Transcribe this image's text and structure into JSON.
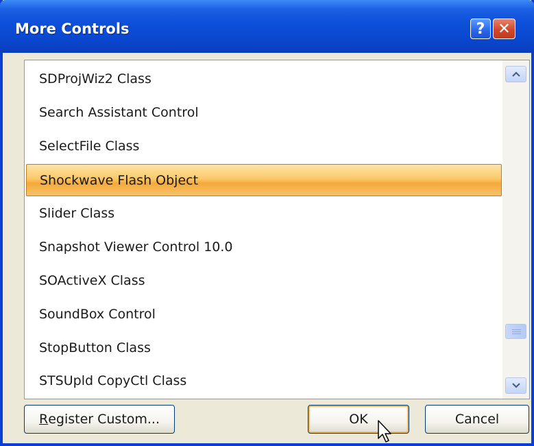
{
  "window": {
    "title": "More Controls"
  },
  "titlebar_buttons": {
    "help": "?",
    "close": "✕"
  },
  "list": {
    "items": [
      "SDProjWiz2 Class",
      "Search Assistant Control",
      "SelectFile Class",
      "Shockwave Flash Object",
      "Slider Class",
      "Snapshot Viewer Control 10.0",
      "SOActiveX Class",
      "SoundBox Control",
      "StopButton Class",
      "STSUpld CopyCtl Class"
    ],
    "selected_item": "Shockwave Flash Object"
  },
  "buttons": {
    "register_first_letter": "R",
    "register_rest": "egister Custom...",
    "ok": "OK",
    "cancel": "Cancel"
  },
  "icons": {
    "scroll_up": "chevron-up-icon",
    "scroll_down": "chevron-down-icon",
    "cursor": "mouse-pointer-icon"
  },
  "colors": {
    "titlebar": "#0a47cf",
    "selection": "#fbc96b",
    "dialog_bg": "#ece9d8"
  }
}
